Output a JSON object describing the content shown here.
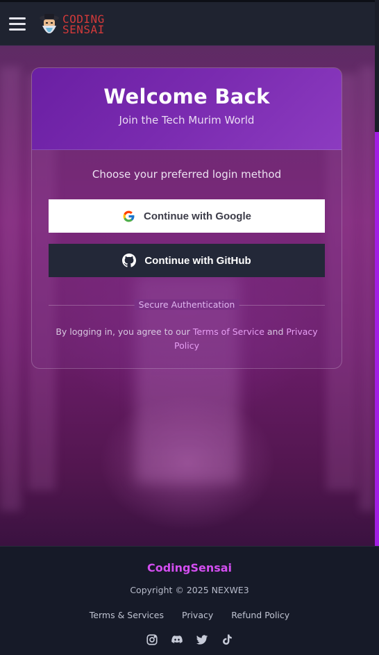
{
  "header": {
    "logo_line1": "CODING",
    "logo_line2": "SENSAI"
  },
  "card": {
    "title": "Welcome Back",
    "subtitle": "Join the Tech Murim World",
    "prompt": "Choose your preferred login method",
    "google_label": "Continue with Google",
    "github_label": "Continue with GitHub",
    "divider_label": "Secure Authentication",
    "legal_prefix": "By logging in, you agree to our",
    "terms_link": "Terms of Service",
    "legal_and": "and",
    "privacy_link": "Privacy Policy"
  },
  "footer": {
    "brand": "CodingSensai",
    "copyright": "Copyright © 2025 NEXWE3",
    "links": [
      "Terms & Services",
      "Privacy",
      "Refund Policy"
    ],
    "socials": [
      "instagram-icon",
      "discord-icon",
      "twitter-icon",
      "tiktok-icon"
    ]
  },
  "colors": {
    "accent": "#d34ef0",
    "logo_red": "#d43a3a",
    "scrollbar": "#a21ee3"
  }
}
